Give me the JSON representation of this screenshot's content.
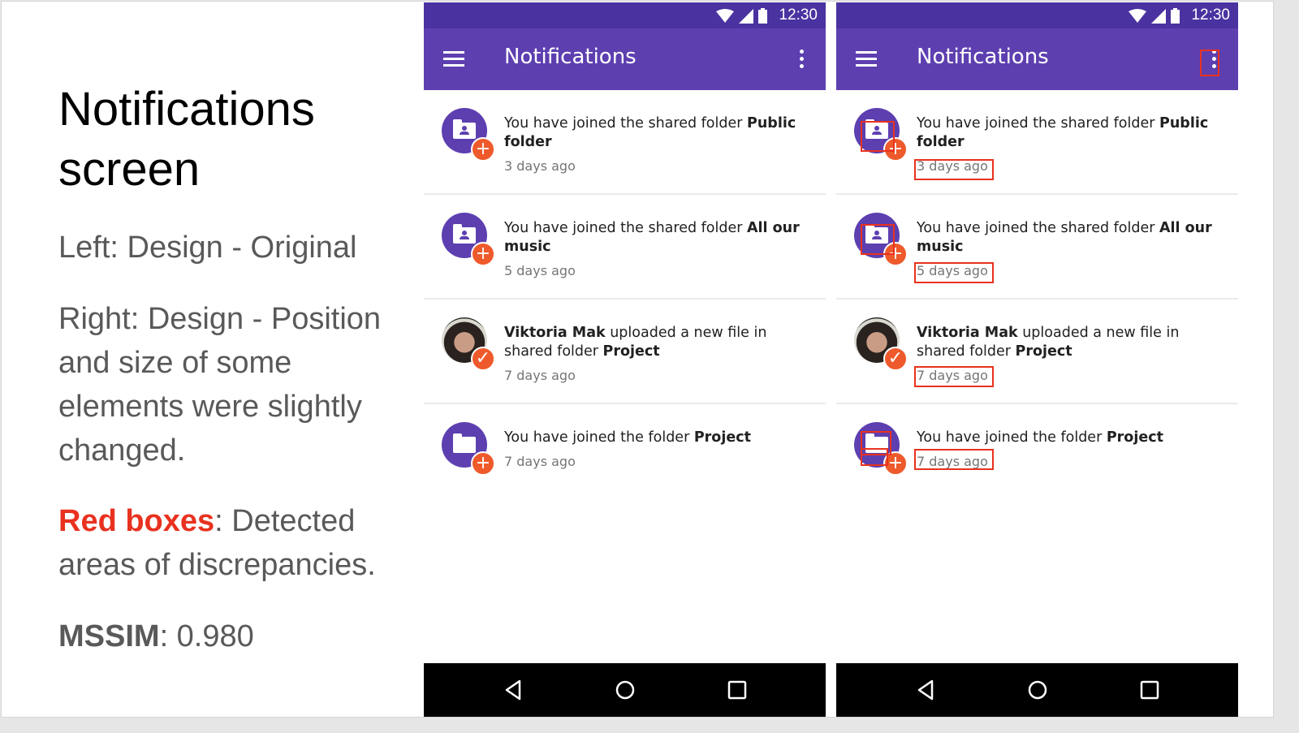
{
  "slide": {
    "title": "Notifications screen",
    "left_caption": "Left: Design - Original",
    "right_caption": "Right: Design - Position and size of some elements were slightly changed.",
    "legend_label": "Red boxes",
    "legend_text": ": Detected areas of discrepancies.",
    "metric_label": "MSSIM",
    "metric_value": ": 0.980",
    "accent_color": "#e8321f"
  },
  "phones": [
    {
      "variant": "original",
      "status_time": "12:30",
      "appbar_title": "Notifications",
      "notifications": [
        {
          "icon": "shared-folder-icon",
          "prefix": "You have joined the shared folder ",
          "bold": "Public folder",
          "suffix": "",
          "time": "3 days ago",
          "badge": "+"
        },
        {
          "icon": "shared-folder-icon",
          "prefix": "You have joined the shared folder ",
          "bold": "All our music",
          "suffix": "",
          "time": "5 days ago",
          "badge": "+"
        },
        {
          "icon": "user-photo",
          "bold_lead": "Viktoria Mak",
          "prefix": " uploaded a new file in shared folder ",
          "bold": "Project",
          "time": "7 days ago",
          "badge": "✓"
        },
        {
          "icon": "folder-icon",
          "prefix": "You have joined the folder ",
          "bold": "Project",
          "suffix": "",
          "time": "7 days ago",
          "badge": "+"
        }
      ]
    },
    {
      "variant": "modified",
      "status_time": "12:30",
      "appbar_title": "Notifications",
      "notifications": [
        {
          "icon": "shared-folder-icon",
          "prefix": "You have joined the shared folder ",
          "bold": "Public folder",
          "suffix": "",
          "time": "3 days ago",
          "badge": "+"
        },
        {
          "icon": "shared-folder-icon",
          "prefix": "You have joined the shared folder ",
          "bold": "All our music",
          "suffix": "",
          "time": "5 days ago",
          "badge": "+"
        },
        {
          "icon": "user-photo",
          "bold_lead": "Viktoria Mak",
          "prefix": " uploaded a new file in shared folder ",
          "bold": "Project",
          "time": "7 days ago",
          "badge": "✓"
        },
        {
          "icon": "folder-icon",
          "prefix": "You have joined the folder ",
          "bold": "Project",
          "suffix": "",
          "time": "7 days ago",
          "badge": "+"
        }
      ]
    }
  ]
}
